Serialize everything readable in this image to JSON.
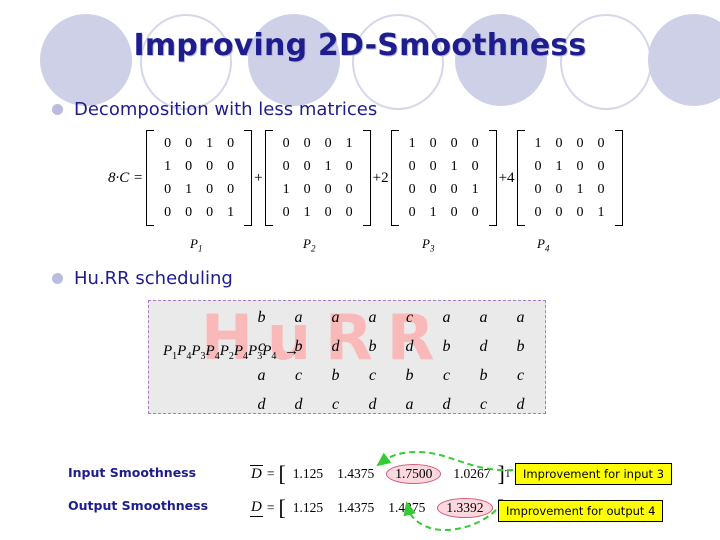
{
  "slide": {
    "title": "Improving 2D-Smoothness",
    "accent_color": "#1d1d8f",
    "deco_circle_color": "#ced0e8",
    "callout_color": "#ffff00",
    "highlight_circle_color": "#fbd7de",
    "arrow_color": "#33cc33"
  },
  "bullets": {
    "decomposition": "Decomposition with less matrices",
    "hurr": "Hu.RR scheduling"
  },
  "equation": {
    "lead": "8·C =",
    "plus": "+",
    "plus2": "+2",
    "plus4": "+4",
    "matrices": [
      {
        "label": "P",
        "sub": "1",
        "rows": [
          [
            "0",
            "0",
            "1",
            "0"
          ],
          [
            "1",
            "0",
            "0",
            "0"
          ],
          [
            "0",
            "1",
            "0",
            "0"
          ],
          [
            "0",
            "0",
            "0",
            "1"
          ]
        ]
      },
      {
        "label": "P",
        "sub": "2",
        "rows": [
          [
            "0",
            "0",
            "0",
            "1"
          ],
          [
            "0",
            "0",
            "1",
            "0"
          ],
          [
            "1",
            "0",
            "0",
            "0"
          ],
          [
            "0",
            "1",
            "0",
            "0"
          ]
        ]
      },
      {
        "label": "P",
        "sub": "3",
        "rows": [
          [
            "1",
            "0",
            "0",
            "0"
          ],
          [
            "0",
            "0",
            "1",
            "0"
          ],
          [
            "0",
            "0",
            "0",
            "1"
          ],
          [
            "0",
            "1",
            "0",
            "0"
          ]
        ]
      },
      {
        "label": "P",
        "sub": "4",
        "rows": [
          [
            "1",
            "0",
            "0",
            "0"
          ],
          [
            "0",
            "1",
            "0",
            "0"
          ],
          [
            "0",
            "0",
            "1",
            "0"
          ],
          [
            "0",
            "0",
            "0",
            "1"
          ]
        ]
      }
    ]
  },
  "schedule": {
    "watermark": "HuRR",
    "prefix_terms": [
      "1",
      "4",
      "3",
      "4",
      "2",
      "4",
      "3",
      "4"
    ],
    "prefix_symbol": "P",
    "arrow": "→",
    "grid": [
      [
        "b",
        "a",
        "a",
        "a",
        "c",
        "a",
        "a",
        "a"
      ],
      [
        "c",
        "b",
        "d",
        "b",
        "d",
        "b",
        "d",
        "b"
      ],
      [
        "a",
        "c",
        "b",
        "c",
        "b",
        "c",
        "b",
        "c"
      ],
      [
        "d",
        "d",
        "c",
        "d",
        "a",
        "d",
        "c",
        "d"
      ]
    ]
  },
  "smoothness": {
    "input": {
      "label": "Input Smoothness",
      "symbol": "D",
      "equals": "=",
      "values": [
        "1.125",
        "1.4375",
        "1.7500",
        "1.0267"
      ],
      "highlight_index": 2,
      "transpose": "T",
      "callout": "Improvement for input 3"
    },
    "output": {
      "label": "Output Smoothness",
      "symbol": "D",
      "equals": "=",
      "values": [
        "1.125",
        "1.4375",
        "1.4375",
        "1.3392"
      ],
      "highlight_index": 3,
      "transpose": "",
      "callout": "Improvement for output 4"
    }
  }
}
